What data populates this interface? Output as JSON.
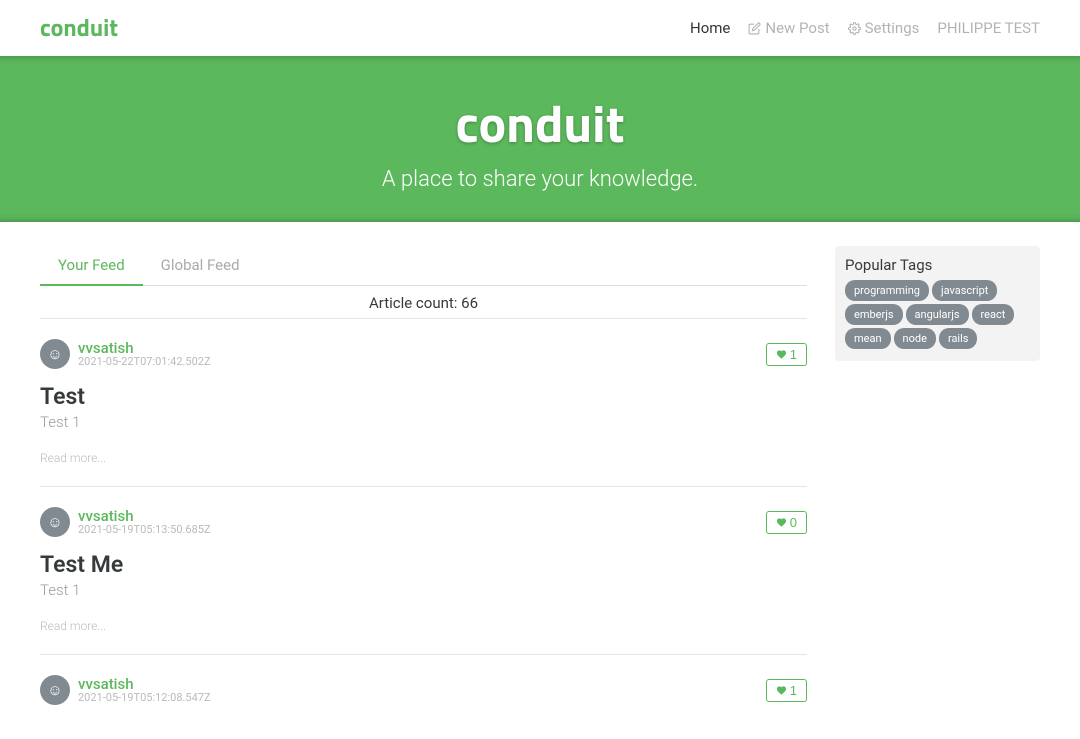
{
  "brand": "conduit",
  "nav": {
    "home": "Home",
    "newPost": "New Post",
    "settings": "Settings",
    "username": "PHILIPPE TEST"
  },
  "banner": {
    "title": "conduit",
    "subtitle": "A place to share your knowledge."
  },
  "feed": {
    "tabs": [
      {
        "label": "Your Feed",
        "active": true
      },
      {
        "label": "Global Feed",
        "active": false
      }
    ],
    "articleCount": "Article count: 66"
  },
  "articles": [
    {
      "author": "vvsatish",
      "date": "2021-05-22T07:01:42.502Z",
      "likes": "1",
      "title": "Test",
      "desc": "Test 1",
      "readMore": "Read more..."
    },
    {
      "author": "vvsatish",
      "date": "2021-05-19T05:13:50.685Z",
      "likes": "0",
      "title": "Test Me",
      "desc": "Test 1",
      "readMore": "Read more..."
    },
    {
      "author": "vvsatish",
      "date": "2021-05-19T05:12:08.547Z",
      "likes": "1",
      "title": "",
      "desc": "",
      "readMore": ""
    }
  ],
  "sidebar": {
    "title": "Popular Tags",
    "tags": [
      "programming",
      "javascript",
      "emberjs",
      "angularjs",
      "react",
      "mean",
      "node",
      "rails"
    ]
  }
}
